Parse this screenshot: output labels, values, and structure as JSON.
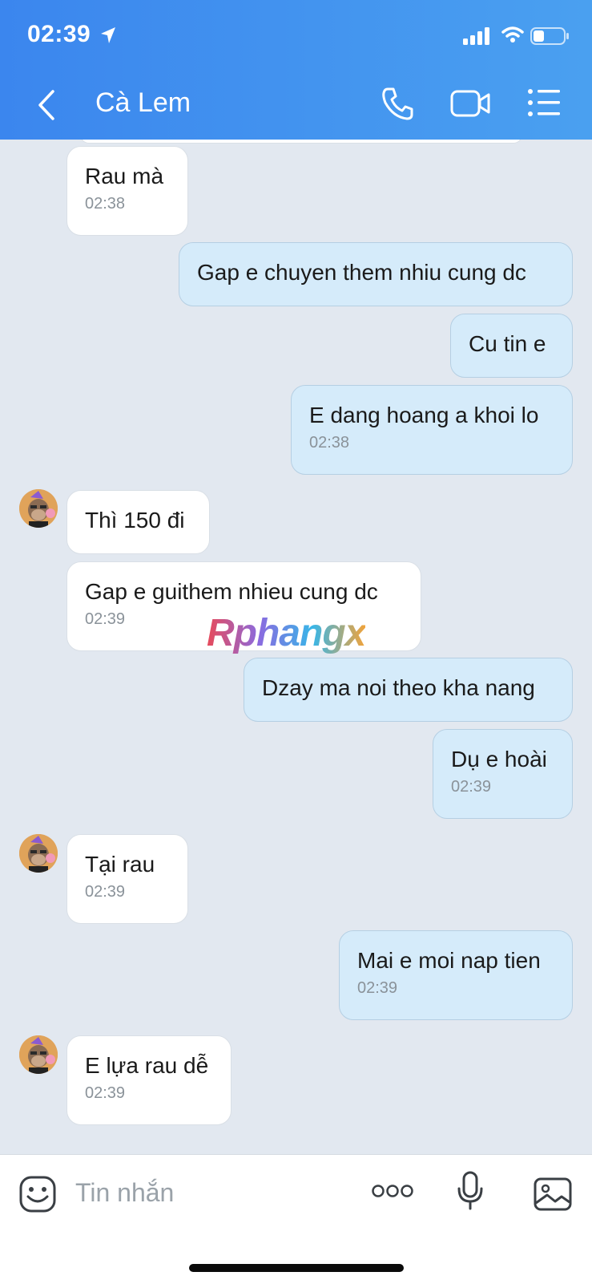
{
  "status_bar": {
    "time": "02:39"
  },
  "header": {
    "contact_name": "Cà Lem"
  },
  "icons": {
    "back": "chevron-left-icon",
    "call": "phone-icon",
    "video": "video-camera-icon",
    "menu": "list-menu-icon",
    "emoji": "sticker-emoji-icon",
    "more": "more-dots-icon",
    "mic": "microphone-icon",
    "image": "image-icon"
  },
  "colors": {
    "header_gradient_start": "#3b86ee",
    "header_gradient_end": "#4aa0f0",
    "incoming_bubble": "#ffffff",
    "outgoing_bubble": "#d5ebfa",
    "chat_background": "#e2e8f0"
  },
  "messages": [
    {
      "direction": "in",
      "text": "Rau mà",
      "time": "02:38"
    },
    {
      "direction": "out",
      "text": "Gap e chuyen them nhiu cung dc",
      "time": ""
    },
    {
      "direction": "out",
      "text": "Cu tin e",
      "time": ""
    },
    {
      "direction": "out",
      "text": "E dang hoang a khoi lo",
      "time": "02:38"
    },
    {
      "direction": "in",
      "text": "Thì 150 đi",
      "time": ""
    },
    {
      "direction": "in",
      "text": "Gap e guithem nhieu cung dc",
      "time": "02:39"
    },
    {
      "direction": "out",
      "text": "Dzay ma noi theo kha nang",
      "time": ""
    },
    {
      "direction": "out",
      "text": "Dụ e hoài",
      "time": "02:39"
    },
    {
      "direction": "in",
      "text": "Tại rau",
      "time": "02:39"
    },
    {
      "direction": "out",
      "text": "Mai e moi nap tien",
      "time": "02:39"
    },
    {
      "direction": "in",
      "text": "E lựa rau dễ",
      "time": "02:39"
    }
  ],
  "watermark": "Rphangx",
  "composer": {
    "placeholder": "Tin nhắn"
  }
}
